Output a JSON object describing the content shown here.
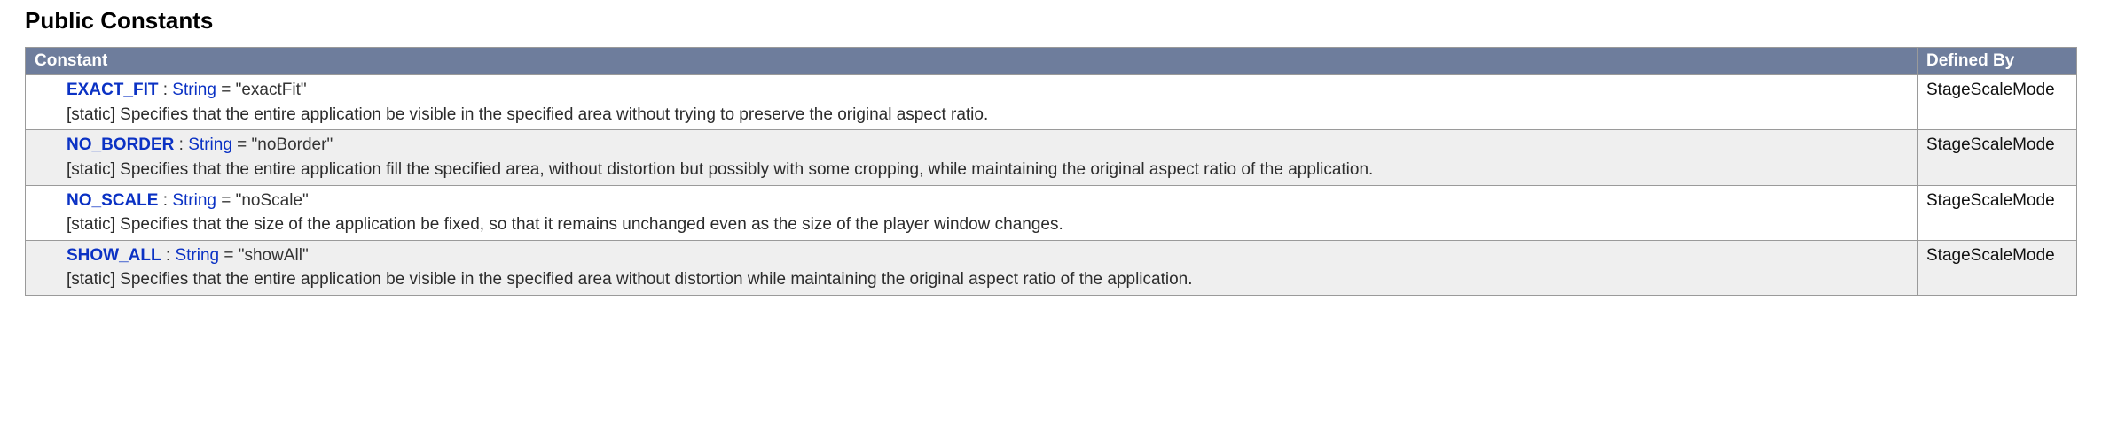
{
  "section_title": "Public Constants",
  "headers": {
    "constant": "Constant",
    "defined_by": "Defined By"
  },
  "rows": [
    {
      "name": "EXACT_FIT",
      "sep1": " : ",
      "type": "String",
      "sep2": " = ",
      "value": "\"exactFit\"",
      "desc": "[static] Specifies that the entire application be visible in the specified area without trying to preserve the original aspect ratio.",
      "defined_by": "StageScaleMode"
    },
    {
      "name": "NO_BORDER",
      "sep1": " : ",
      "type": "String",
      "sep2": " = ",
      "value": "\"noBorder\"",
      "desc": "[static] Specifies that the entire application fill the specified area, without distortion but possibly with some cropping, while maintaining the original aspect ratio of the application.",
      "defined_by": "StageScaleMode"
    },
    {
      "name": "NO_SCALE",
      "sep1": " : ",
      "type": "String",
      "sep2": " = ",
      "value": "\"noScale\"",
      "desc": "[static] Specifies that the size of the application be fixed, so that it remains unchanged even as the size of the player window changes.",
      "defined_by": "StageScaleMode"
    },
    {
      "name": "SHOW_ALL",
      "sep1": " : ",
      "type": "String",
      "sep2": " = ",
      "value": "\"showAll\"",
      "desc": "[static] Specifies that the entire application be visible in the specified area without distortion while maintaining the original aspect ratio of the application.",
      "defined_by": "StageScaleMode"
    }
  ]
}
